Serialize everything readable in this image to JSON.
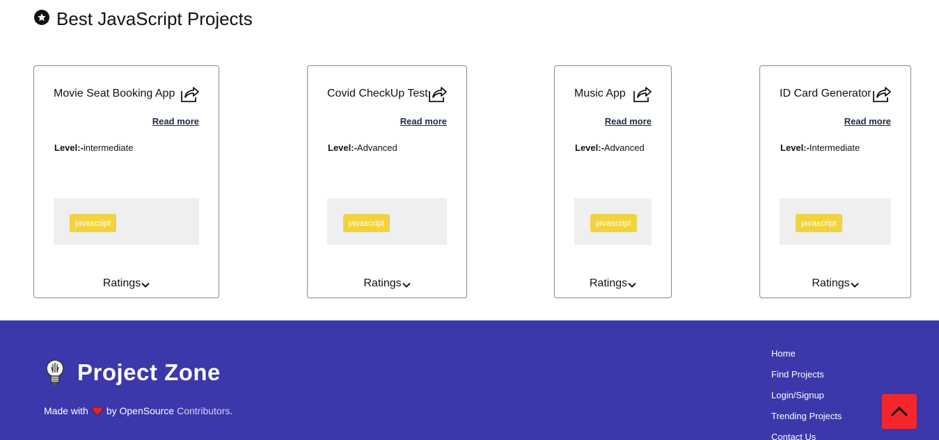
{
  "section": {
    "title": "Best JavaScript Projects",
    "icon": "star-circle-icon"
  },
  "cards": [
    {
      "title": "Movie Seat Booking App",
      "read_more": "Read more",
      "level_label": "Level:-",
      "level": "intermediate",
      "tag": "javascript",
      "ratings": "Ratings"
    },
    {
      "title": "Covid CheckUp Test",
      "read_more": "Read more",
      "level_label": "Level:-",
      "level": "Advanced",
      "tag": "javascript",
      "ratings": "Ratings"
    },
    {
      "title": "Music App",
      "read_more": "Read more",
      "level_label": "Level:-",
      "level": "Advanced",
      "tag": "javascript",
      "ratings": "Ratings"
    },
    {
      "title": "ID Card Generator",
      "read_more": "Read more",
      "level_label": "Level:-",
      "level": "Intermediate",
      "tag": "javascript",
      "ratings": "Ratings"
    }
  ],
  "footer": {
    "brand": "Project Zone",
    "made_with": "Made with",
    "by": "by OpenSource",
    "contributors": "Contributors",
    "period": ".",
    "links": [
      "Home",
      "Find Projects",
      "Login/Signup",
      "Trending Projects",
      "Contact Us"
    ]
  },
  "colors": {
    "footer_bg": "#3a38ab",
    "tag_bg": "#f0d33d",
    "back_to_top_bg": "#f4262c",
    "heart": "#e8232a"
  }
}
